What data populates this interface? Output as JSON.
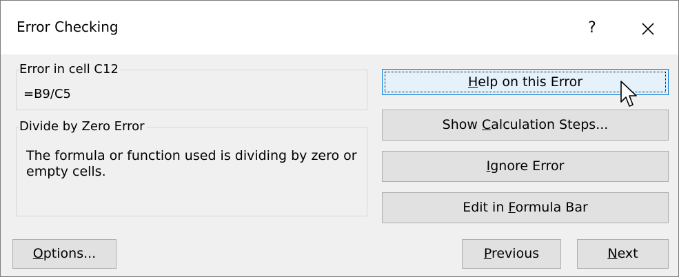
{
  "dialog": {
    "title": "Error Checking",
    "help_glyph": "?",
    "close_icon": "close-icon"
  },
  "error_location": {
    "label": "Error in cell C12",
    "formula": "=B9/C5"
  },
  "error_type": {
    "label": "Divide by Zero Error",
    "description": "The formula or function used is dividing by zero or empty cells."
  },
  "actions": {
    "help": {
      "pre": "",
      "key": "H",
      "post": "elp on this Error"
    },
    "calc": {
      "pre": "Show ",
      "key": "C",
      "post": "alculation Steps..."
    },
    "ignore": {
      "pre": "",
      "key": "I",
      "post": "gnore Error"
    },
    "formula_bar": {
      "pre": "Edit in ",
      "key": "F",
      "post": "ormula Bar"
    }
  },
  "footer": {
    "options": {
      "pre": "",
      "key": "O",
      "post": "ptions..."
    },
    "previous": {
      "pre": "",
      "key": "P",
      "post": "revious"
    },
    "next": {
      "pre": "",
      "key": "N",
      "post": "ext"
    }
  },
  "colors": {
    "dialog_bg": "#f0f0f0",
    "button_bg": "#e1e1e1",
    "focused_button_bg": "#e5f1fb",
    "focus_border": "#0078d7"
  }
}
